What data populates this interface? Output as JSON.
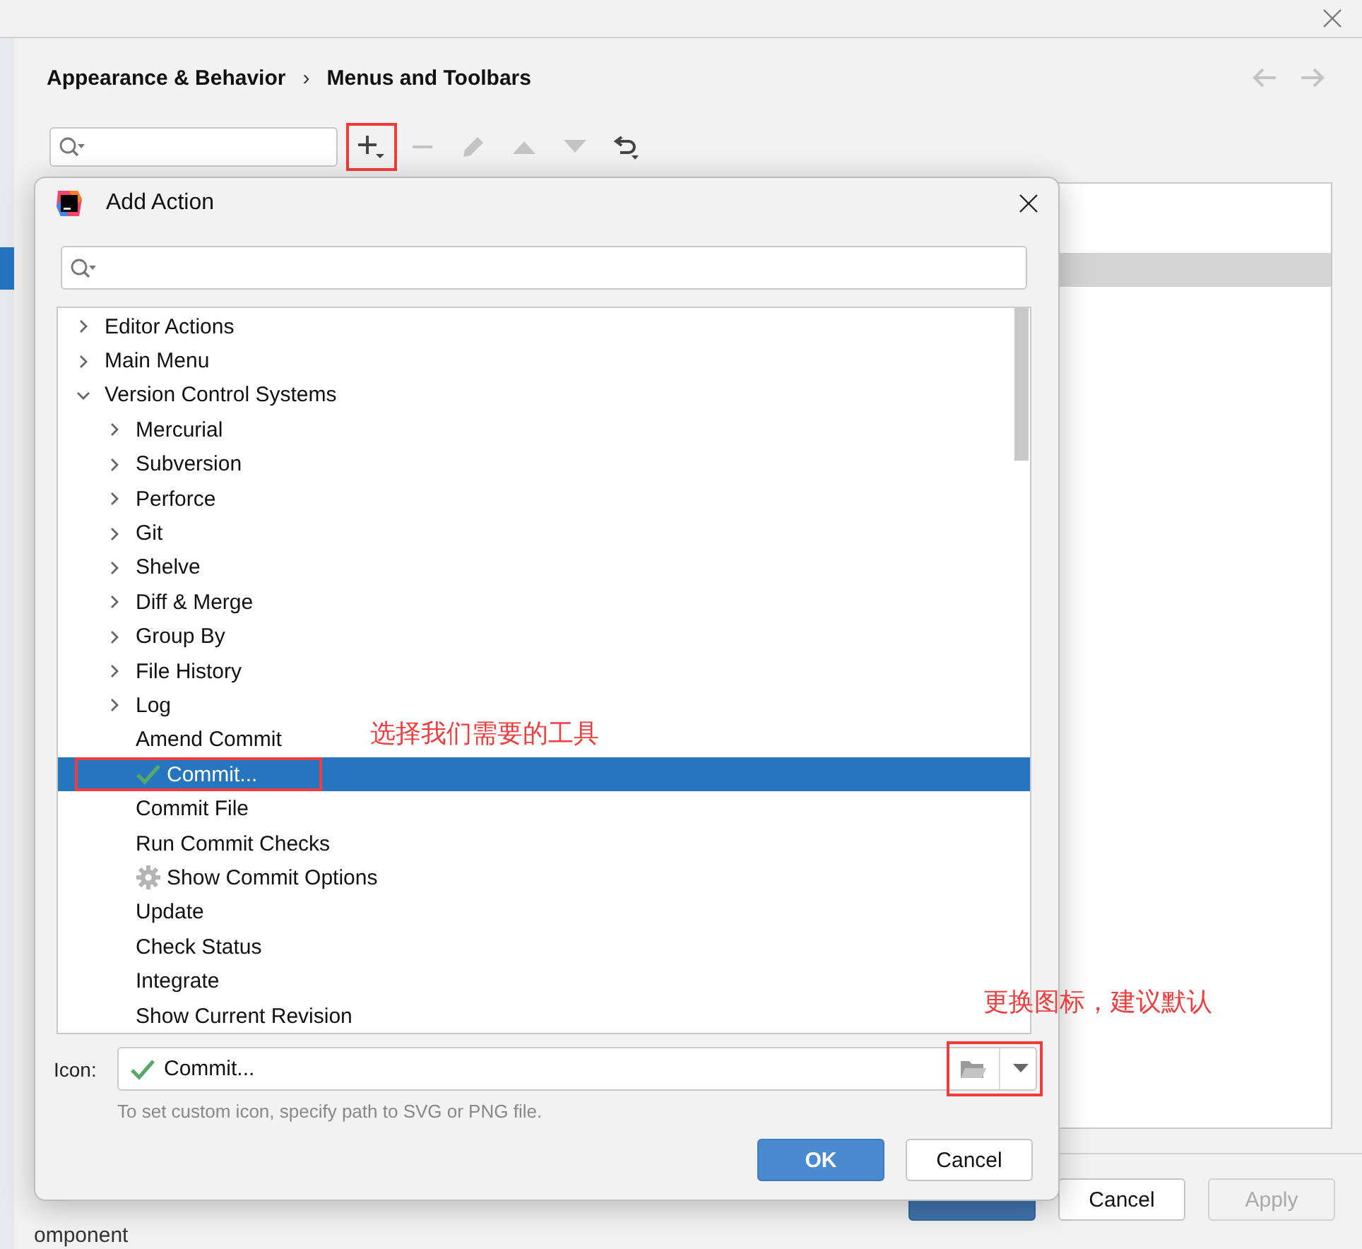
{
  "settings": {
    "breadcrumb": [
      "Appearance & Behavior",
      "Menus and Toolbars"
    ],
    "breadcrumb_separator": "›",
    "nav": [
      {
        "kind": "back",
        "disabled": true
      },
      {
        "kind": "forward",
        "disabled": true
      }
    ],
    "toolbar": [
      {
        "kind": "add",
        "disabled": false,
        "highlighted": true
      },
      {
        "kind": "remove",
        "disabled": true,
        "highlighted": false
      },
      {
        "kind": "edit",
        "disabled": true,
        "highlighted": false
      },
      {
        "kind": "up",
        "disabled": true,
        "highlighted": false
      },
      {
        "kind": "down",
        "disabled": true,
        "highlighted": false
      },
      {
        "kind": "restore",
        "disabled": false,
        "highlighted": false
      }
    ],
    "list_rows": [
      {
        "selected": false
      },
      {
        "selected": true
      }
    ],
    "buttons": [
      {
        "kind": "primary",
        "disabled": false
      },
      {
        "label": "Cancel",
        "kind": "normal",
        "disabled": false
      },
      {
        "label": "Apply",
        "kind": "normal",
        "disabled": true
      }
    ],
    "footer_text": "omponent"
  },
  "dialog": {
    "title": "Add Action",
    "tree": [
      {
        "label": "Editor Actions",
        "kind": "group",
        "expanded": false,
        "selected": false
      },
      {
        "label": "Main Menu",
        "kind": "group",
        "expanded": false,
        "selected": false
      },
      {
        "label": "Version Control Systems",
        "kind": "group",
        "expanded": true,
        "selected": false,
        "children": [
          {
            "label": "Mercurial",
            "kind": "group",
            "expanded": false,
            "selected": false
          },
          {
            "label": "Subversion",
            "kind": "group",
            "expanded": false,
            "selected": false
          },
          {
            "label": "Perforce",
            "kind": "group",
            "expanded": false,
            "selected": false
          },
          {
            "label": "Git",
            "kind": "group",
            "expanded": false,
            "selected": false
          },
          {
            "label": "Shelve",
            "kind": "group",
            "expanded": false,
            "selected": false
          },
          {
            "label": "Diff & Merge",
            "kind": "group",
            "expanded": false,
            "selected": false
          },
          {
            "label": "Group By",
            "kind": "group",
            "expanded": false,
            "selected": false
          },
          {
            "label": "File History",
            "kind": "group",
            "expanded": false,
            "selected": false
          },
          {
            "label": "Log",
            "kind": "group",
            "expanded": false,
            "selected": false
          },
          {
            "label": "Amend Commit",
            "kind": "action",
            "selected": false
          },
          {
            "label": "Commit...",
            "kind": "commit",
            "selected": true,
            "highlighted": true
          },
          {
            "label": "Commit File",
            "kind": "action",
            "selected": false
          },
          {
            "label": "Run Commit Checks",
            "kind": "action",
            "selected": false
          },
          {
            "label": "Show Commit Options",
            "kind": "options",
            "selected": false
          },
          {
            "label": "Update",
            "kind": "action",
            "selected": false
          },
          {
            "label": "Check Status",
            "kind": "action",
            "selected": false
          },
          {
            "label": "Integrate",
            "kind": "action",
            "selected": false
          },
          {
            "label": "Show Current Revision",
            "kind": "action",
            "selected": false
          }
        ]
      }
    ],
    "icon_field": {
      "label": "Icon:",
      "value": "Commit...",
      "highlighted": true
    },
    "hint": "To set custom icon, specify path to SVG or PNG file.",
    "buttons": [
      {
        "label": "OK",
        "kind": "primary",
        "disabled": false
      },
      {
        "label": "Cancel",
        "kind": "normal",
        "disabled": false
      }
    ]
  },
  "annotations": [
    {
      "kind": "tree",
      "text": "选择我们需要的工具"
    },
    {
      "kind": "icon",
      "text": "更换图标，建议默认"
    }
  ]
}
